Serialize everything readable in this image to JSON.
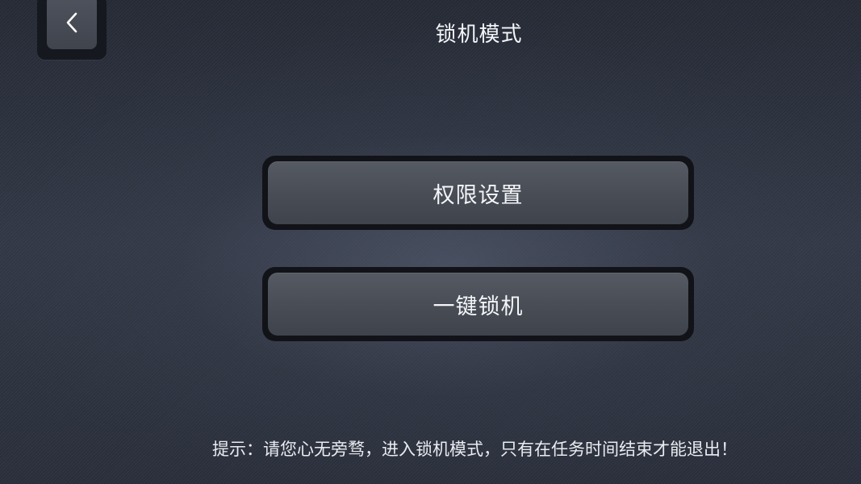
{
  "header": {
    "title": "锁机模式",
    "back_icon": "chevron-left-icon"
  },
  "menu": {
    "items": [
      {
        "label": "权限设置"
      },
      {
        "label": "一键锁机"
      }
    ]
  },
  "footer": {
    "hint": "提示：请您心无旁骛，进入锁机模式，只有在任务时间结束才能退出！"
  },
  "colors": {
    "background": "#2f3542",
    "button": "#4b4f58",
    "button_frame": "#111318",
    "text": "#f3f5f8"
  }
}
